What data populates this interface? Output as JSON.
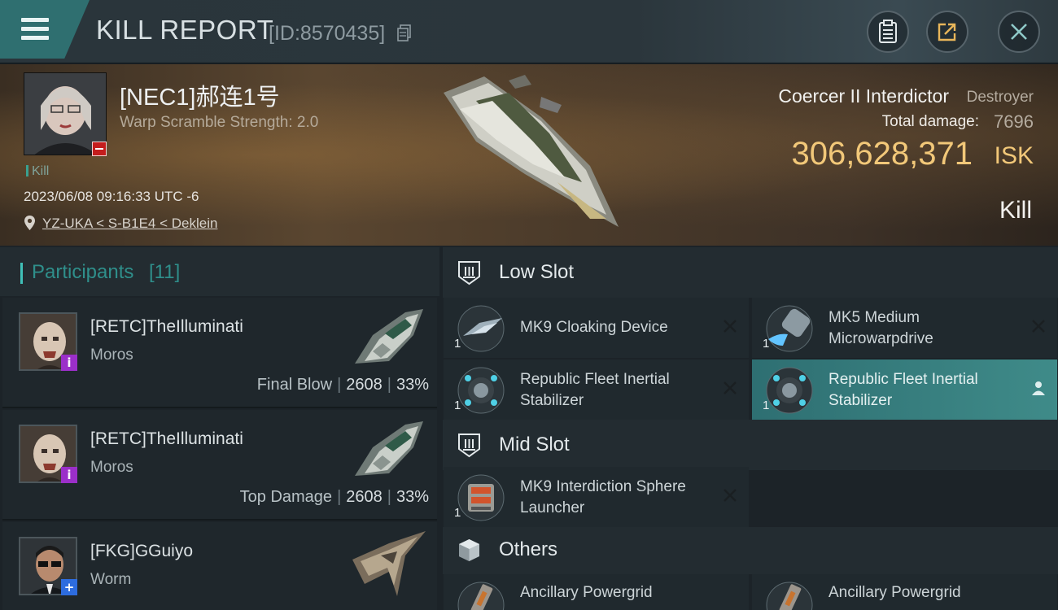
{
  "header": {
    "title": "KILL REPORT",
    "report_id": "[ID:8570435]"
  },
  "victim": {
    "name": "[NEC1]郝连1号",
    "warp_scramble": "Warp Scramble Strength: 2.0",
    "tag": "Kill",
    "datetime": "2023/06/08 09:16:33 UTC -6",
    "location": "YZ-UKA < S-B1E4 < Deklein",
    "ship_name": "Coercer II Interdictor",
    "ship_class": "Destroyer",
    "total_damage_label": "Total damage:",
    "total_damage": "7696",
    "isk_value": "306,628,371",
    "isk_unit": "ISK",
    "result": "Kill"
  },
  "participants": {
    "title": "Participants",
    "count": "[11]",
    "rows": [
      {
        "name": "[RETC]TheIlluminati",
        "ship": "Moros",
        "role": "Final Blow",
        "damage": "2608",
        "percent": "33%",
        "badge": "i"
      },
      {
        "name": "[RETC]TheIlluminati",
        "ship": "Moros",
        "role": "Top Damage",
        "damage": "2608",
        "percent": "33%",
        "badge": "i"
      },
      {
        "name": "[FKG]GGuiyo",
        "ship": "Worm",
        "role": "",
        "damage": "",
        "percent": "",
        "badge": "+"
      }
    ]
  },
  "slots": {
    "low": {
      "title": "Low Slot",
      "modules": [
        {
          "name": "MK9 Cloaking Device",
          "qty": "1"
        },
        {
          "name": "MK5 Medium Microwarpdrive",
          "qty": "1"
        },
        {
          "name": "Republic Fleet Inertial Stabilizer",
          "qty": "1"
        },
        {
          "name": "Republic Fleet Inertial Stabilizer",
          "qty": "1"
        }
      ]
    },
    "mid": {
      "title": "Mid Slot",
      "modules": [
        {
          "name": "MK9 Interdiction Sphere Launcher",
          "qty": "1"
        }
      ]
    },
    "others": {
      "title": "Others",
      "modules": [
        {
          "name": "Ancillary Powergrid",
          "qty": ""
        },
        {
          "name": "Ancillary Powergrid",
          "qty": ""
        }
      ]
    }
  },
  "colors": {
    "accent": "#3f8b89",
    "isk": "#f2c879",
    "destroyed_badge": "#c41d1d"
  }
}
